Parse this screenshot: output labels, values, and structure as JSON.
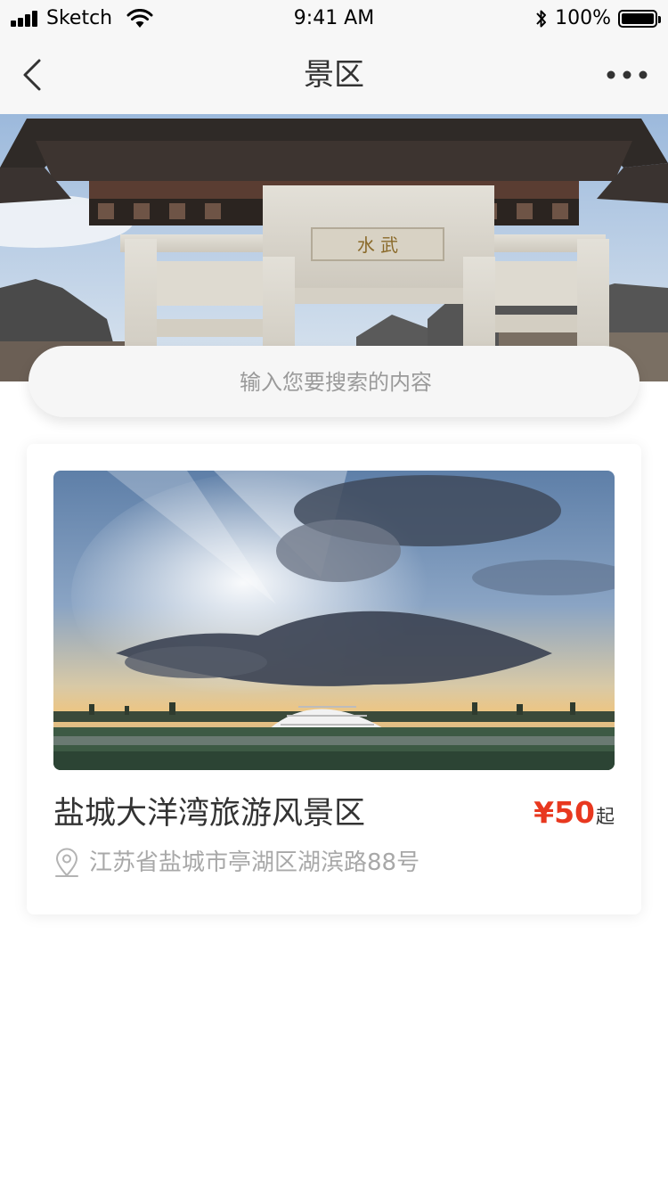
{
  "status_bar": {
    "carrier": "Sketch",
    "time": "9:41 AM",
    "battery": "100%",
    "battery_level": 1.0
  },
  "nav": {
    "title": "景区",
    "back_icon": "chevron-left-icon",
    "more_icon": "more-dots-icon"
  },
  "search": {
    "placeholder": "输入您要搜索的内容"
  },
  "scenic": {
    "name": "盐城大洋湾旅游风景区",
    "price": "¥50",
    "price_suffix": "起",
    "address": "江苏省盐城市亭湖区湖滨路88号",
    "location_icon": "location-pin-icon"
  },
  "hero_sign": "水 武",
  "colors": {
    "accent_price": "#e8381f",
    "nav_background": "#f7f7f7",
    "title_text": "#333333",
    "secondary_text": "#a8a8a8"
  }
}
